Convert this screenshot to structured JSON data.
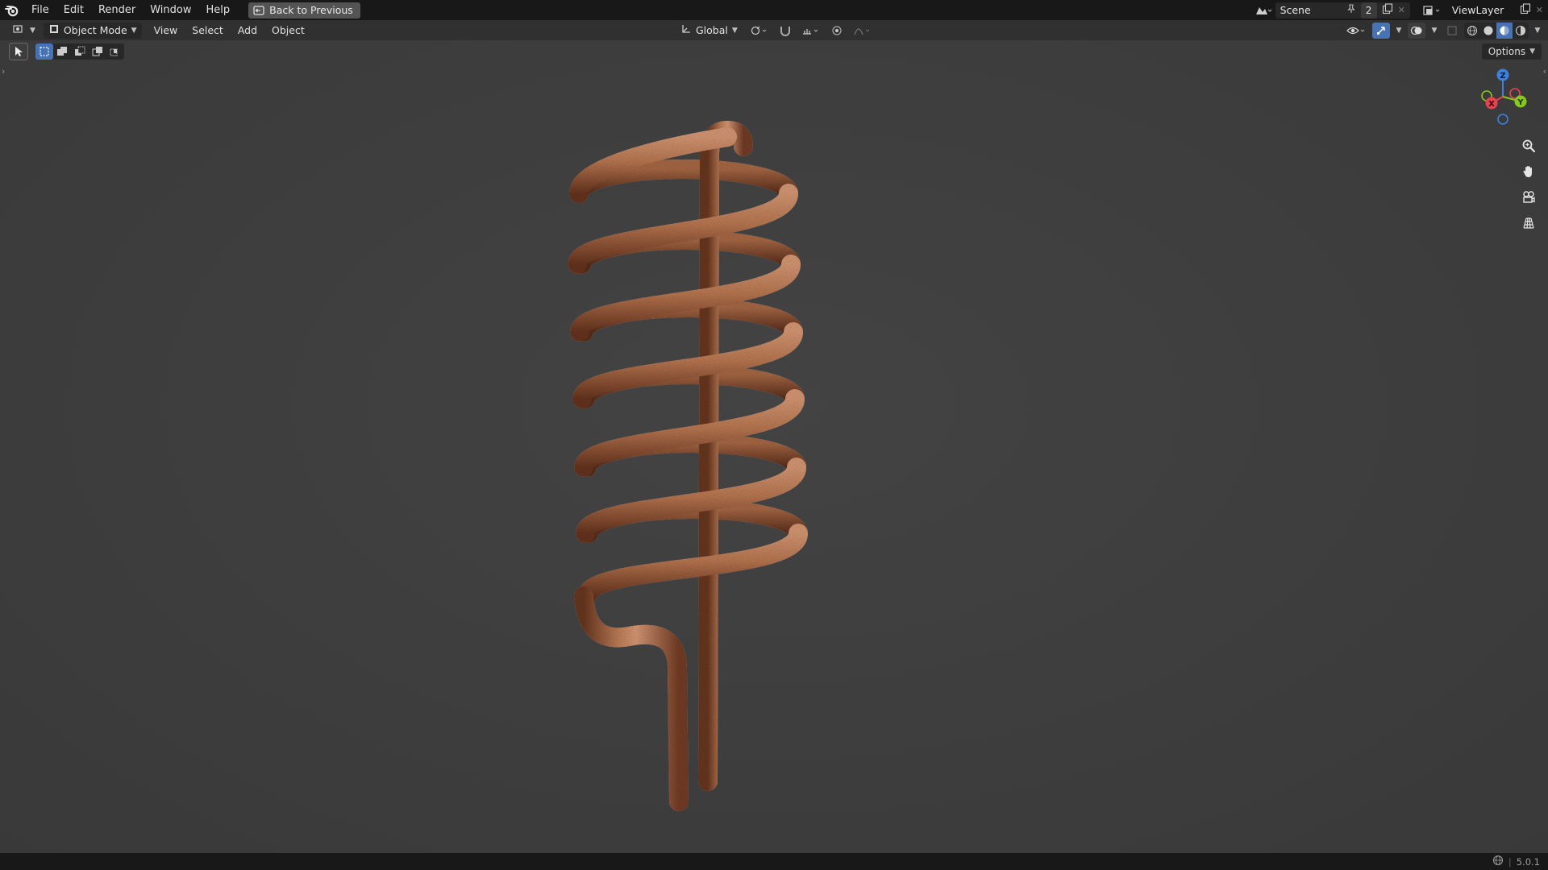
{
  "topbar": {
    "menus": [
      "File",
      "Edit",
      "Render",
      "Window",
      "Help"
    ],
    "back_button": "Back to Previous",
    "scene": {
      "name": "Scene",
      "users": "2"
    },
    "view_layer": "ViewLayer"
  },
  "viewport_header": {
    "mode": "Object Mode",
    "menus": [
      "View",
      "Select",
      "Add",
      "Object"
    ],
    "transform_orientation": "Global"
  },
  "viewport": {
    "options_label": "Options",
    "gizmo_axes": {
      "x": "X",
      "y": "Y",
      "z": "Z"
    }
  },
  "statusbar": {
    "version": "5.0.1"
  },
  "colors": {
    "accent": "#4772b3",
    "viewport_bg": "#3e3e3e",
    "copper": "#c07a55",
    "axis_x": "#e8424f",
    "axis_y": "#88c81a",
    "axis_z": "#3b82e0"
  },
  "icons": {
    "topbar": [
      "blender-logo-icon",
      "back-screen-icon",
      "scene-icon",
      "pin-icon",
      "new-scene-icon",
      "close-icon",
      "view-layer-icon"
    ],
    "viewport_tools": [
      "cursor-select-icon",
      "box-select-new-icon",
      "box-select-extend-icon",
      "box-select-subtract-icon",
      "box-select-invert-icon",
      "box-select-intersect-icon"
    ],
    "navigation": [
      "zoom-icon",
      "pan-hand-icon",
      "camera-view-icon",
      "ortho-grid-icon"
    ]
  }
}
